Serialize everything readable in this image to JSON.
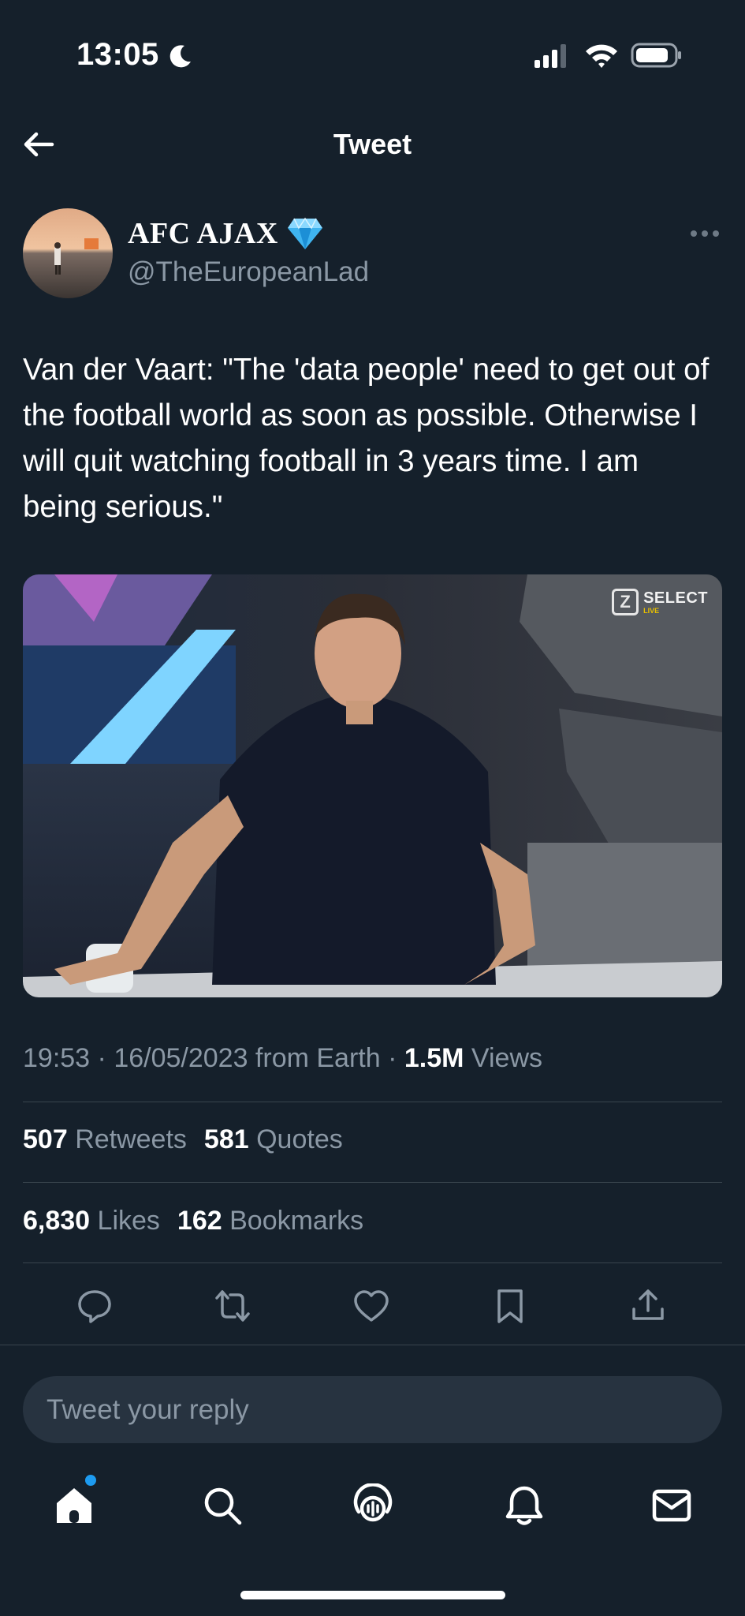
{
  "status_bar": {
    "time": "13:05"
  },
  "header": {
    "title": "Tweet"
  },
  "author": {
    "name": "AFC AJAX",
    "handle": "@TheEuropeanLad"
  },
  "tweet": {
    "text": "Van der Vaart: \"The 'data people' need to get out of the football world as soon as possible. Otherwise I will quit watching football in 3 years time. I am being serious.\"",
    "media_logo": {
      "mark": "Z",
      "text": "SELECT",
      "sub": "LIVE"
    },
    "meta": {
      "time": "19:53",
      "separator": " · ",
      "date": "16/05/2023",
      "source": " from Earth",
      "views_count": "1.5M",
      "views_label": "Views"
    }
  },
  "stats": {
    "retweets_count": "507",
    "retweets_label": "Retweets",
    "quotes_count": "581",
    "quotes_label": "Quotes",
    "likes_count": "6,830",
    "likes_label": "Likes",
    "bookmarks_count": "162",
    "bookmarks_label": "Bookmarks"
  },
  "actions": [
    "reply-icon",
    "retweet-icon",
    "like-icon",
    "bookmark-icon",
    "share-icon"
  ],
  "reply": {
    "placeholder": "Tweet your reply"
  },
  "tab_bar": {
    "tabs": [
      "home-icon",
      "search-icon",
      "spaces-icon",
      "notifications-icon",
      "messages-icon"
    ],
    "accent_color": "#1d9bf0"
  },
  "colors": {
    "background": "#15202b",
    "secondary_text": "#8b98a5",
    "divider": "#38444d"
  }
}
